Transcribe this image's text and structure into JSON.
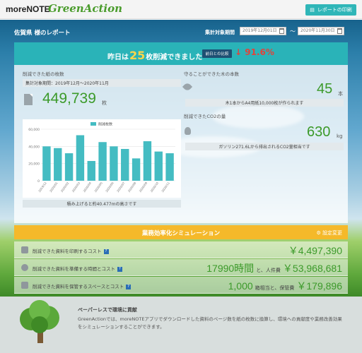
{
  "brand": {
    "name": "moreNOTE",
    "product": "GreenAction"
  },
  "header": {
    "print_button": "レポートの印刷",
    "report_title": "佐賀県 様のレポート",
    "period_label": "集計対象期間",
    "date_from": "2019年12月01日",
    "date_to": "2020年11月30日",
    "separator": "〜"
  },
  "banner": {
    "prefix": "昨日は",
    "count": "25",
    "suffix": "枚削減できました",
    "compare_button": "前日との比較",
    "change": "↓ 91.6%"
  },
  "paper": {
    "label": "削減できた紙の枚数",
    "period": "集計対象期間：2019年12月〜2020年11月",
    "value": "449,739",
    "unit": "枚",
    "note": "積み上げると約40.477mの高さです"
  },
  "trees": {
    "label": "守ることができた木の本数",
    "value": "45",
    "unit": "本",
    "note": "木1本からA4用紙10,000枚が作られます"
  },
  "co2": {
    "label": "削減できたCO2の量",
    "value": "630",
    "unit": "kg",
    "note": "ガソリン271.6Lから排出されるCO2量相当です"
  },
  "simulation": {
    "title": "業務効率化シミュレーション",
    "settings": "設定変更",
    "rows": [
      {
        "label": "削減できた資料を印刷するコスト",
        "value": "￥4,497,390"
      },
      {
        "label": "削減できた資料を準備する時間とコスト",
        "value_main": "17990時間",
        "joiner": "と、人件費",
        "value": "￥53,968,681"
      },
      {
        "label": "削減できた資料を保管するスペースとコスト",
        "value_main": "1,000",
        "joiner": "箱相当と、保管費",
        "value": "￥179,896"
      }
    ]
  },
  "footer": {
    "title": "ペーパーレスで環境に貢献",
    "body": "GreenActionでは、moreNOTEアプリでダウンロードした資料のページ数を紙の枚数に換算し、環境への貢献度や業務改善効果をシミュレーションすることができます。"
  },
  "colors": {
    "teal": "#2ab3b8",
    "green": "#3c9a2a",
    "amber": "#f5b92a",
    "red": "#e0443c",
    "navy": "#1e4f73"
  },
  "chart_data": {
    "type": "bar",
    "categories": [
      "2019/12",
      "2020/01",
      "2020/02",
      "2020/03",
      "2020/04",
      "2020/05",
      "2020/06",
      "2020/07",
      "2020/08",
      "2020/09",
      "2020/10",
      "2020/11"
    ],
    "series": [
      {
        "name": "削減枚数",
        "values": [
          40000,
          38000,
          32000,
          53000,
          23000,
          45000,
          40000,
          37000,
          26000,
          46000,
          34000,
          32000
        ]
      }
    ],
    "ylim": [
      0,
      60000
    ],
    "yticks": [
      "0",
      "20,000",
      "40,000",
      "60,000"
    ],
    "grid": true,
    "legend": "top-center"
  }
}
